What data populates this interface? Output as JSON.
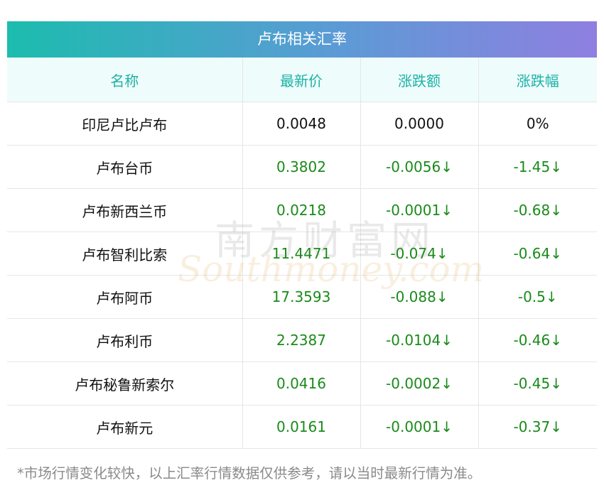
{
  "table_title": "卢布相关汇率",
  "headers": [
    "名称",
    "最新价",
    "涨跌额",
    "涨跌幅"
  ],
  "rows": [
    {
      "name": "印尼卢比卢布",
      "price": "0.0048",
      "change": "0.0000",
      "pct": "0%",
      "down": false
    },
    {
      "name": "卢布台币",
      "price": "0.3802",
      "change": "-0.0056↓",
      "pct": "-1.45↓",
      "down": true
    },
    {
      "name": "卢布新西兰币",
      "price": "0.0218",
      "change": "-0.0001↓",
      "pct": "-0.68↓",
      "down": true
    },
    {
      "name": "卢布智利比索",
      "price": "11.4471",
      "change": "-0.074↓",
      "pct": "-0.64↓",
      "down": true
    },
    {
      "name": "卢布阿币",
      "price": "17.3593",
      "change": "-0.088↓",
      "pct": "-0.5↓",
      "down": true
    },
    {
      "name": "卢布利币",
      "price": "2.2387",
      "change": "-0.0104↓",
      "pct": "-0.46↓",
      "down": true
    },
    {
      "name": "卢布秘鲁新索尔",
      "price": "0.0416",
      "change": "-0.0002↓",
      "pct": "-0.45↓",
      "down": true
    },
    {
      "name": "卢布新元",
      "price": "0.0161",
      "change": "-0.0001↓",
      "pct": "-0.37↓",
      "down": true
    }
  ],
  "watermark": {
    "cn": "南方财富网",
    "en": "Southmoney.com"
  },
  "footnote": "*市场行情变化较快，以上汇率行情数据仅供参考，请以当时最新行情为准。",
  "colors": {
    "header_text": "#1cb2a5",
    "down": "#1a8a1a",
    "title_gradient_start": "#1cbcae",
    "title_gradient_end": "#8f7fe0"
  }
}
